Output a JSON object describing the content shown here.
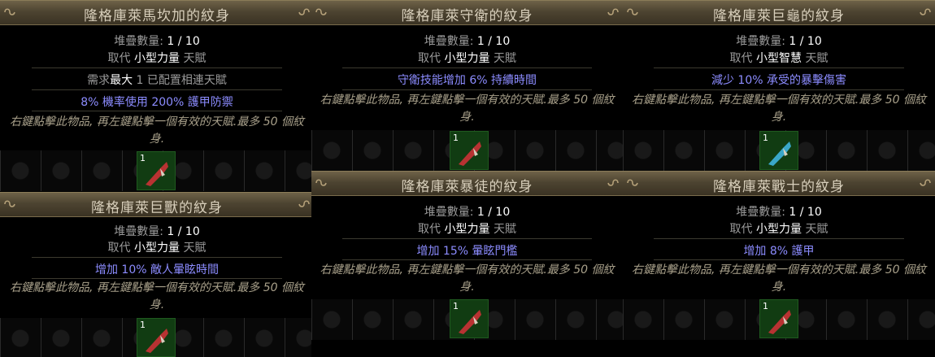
{
  "cards": [
    {
      "title": "隆格庫萊馬坎加的紋身",
      "stack_label": "堆疊數量:",
      "stack_value": "1 / 10",
      "replace_prefix": "取代",
      "replace_target": "小型力量",
      "replace_suffix": "天賦",
      "req_prefix": "需求",
      "req_bold": "最大",
      "req_rest": "1 已配置相連天賦",
      "mod": "8% 機率使用 200% 護甲防禦",
      "flavor": "右鍵點擊此物品, 再左鍵點擊一個有效的天賦.最多 50 個紋身.",
      "icon_qty": "1",
      "icon": "red-tattoo-icon",
      "accent": "#c83a3a"
    },
    {
      "title": "隆格庫萊守衛的紋身",
      "stack_label": "堆疊數量:",
      "stack_value": "1 / 10",
      "replace_prefix": "取代",
      "replace_target": "小型力量",
      "replace_suffix": "天賦",
      "mod": "守衛技能增加 6% 持續時間",
      "flavor": "右鍵點擊此物品, 再左鍵點擊一個有效的天賦.最多 50 個紋身.",
      "icon_qty": "1",
      "icon": "red-tattoo-icon",
      "accent": "#c83a3a"
    },
    {
      "title": "隆格庫萊巨龜的紋身",
      "stack_label": "堆疊數量:",
      "stack_value": "1 / 10",
      "replace_prefix": "取代",
      "replace_target": "小型智慧",
      "replace_suffix": "天賦",
      "mod": "減少 10% 承受的暴擊傷害",
      "flavor": "右鍵點擊此物品, 再左鍵點擊一個有效的天賦.最多 50 個紋身.",
      "icon_qty": "1",
      "icon": "blue-tattoo-icon",
      "accent": "#3aa6c8"
    },
    {
      "title": "隆格庫萊巨獸的紋身",
      "stack_label": "堆疊數量:",
      "stack_value": "1 / 10",
      "replace_prefix": "取代",
      "replace_target": "小型力量",
      "replace_suffix": "天賦",
      "mod": "增加 10% 敵人暈眩時間",
      "flavor": "右鍵點擊此物品, 再左鍵點擊一個有效的天賦.最多 50 個紋身.",
      "icon_qty": "1",
      "icon": "red-tattoo-icon",
      "accent": "#c83a3a"
    },
    {
      "title": "隆格庫萊暴徒的紋身",
      "stack_label": "堆疊數量:",
      "stack_value": "1 / 10",
      "replace_prefix": "取代",
      "replace_target": "小型力量",
      "replace_suffix": "天賦",
      "mod": "增加 15% 暈眩門檻",
      "flavor": "右鍵點擊此物品, 再左鍵點擊一個有效的天賦.最多 50 個紋身.",
      "icon_qty": "1",
      "icon": "red-tattoo-icon",
      "accent": "#c83a3a"
    },
    {
      "title": "隆格庫萊戰士的紋身",
      "stack_label": "堆疊數量:",
      "stack_value": "1 / 10",
      "replace_prefix": "取代",
      "replace_target": "小型力量",
      "replace_suffix": "天賦",
      "mod": "增加 8% 護甲",
      "flavor": "右鍵點擊此物品, 再左鍵點擊一個有效的天賦.最多 50 個紋身.",
      "icon_qty": "1",
      "icon": "red-tattoo-icon",
      "accent": "#c83a3a"
    }
  ]
}
